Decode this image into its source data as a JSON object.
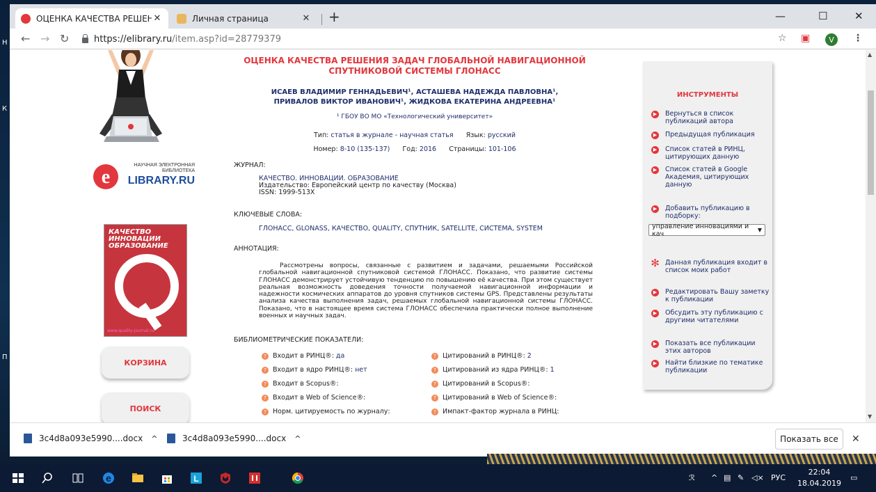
{
  "browser": {
    "tabs": [
      {
        "title": "ОЦЕНКА КАЧЕСТВА РЕШЕНИЯ З",
        "active": true
      },
      {
        "title": "Личная страница",
        "active": false
      }
    ],
    "url_host": "https://elibrary.ru",
    "url_path": "/item.asp?id=28779379",
    "avatar_letter": "V"
  },
  "site": {
    "logo_top": "НАУЧНАЯ ЭЛЕКТРОННАЯ",
    "logo_mid": "БИБЛИОТЕКА",
    "logo_main": "LIBRARY.RU",
    "cover_title": "КАЧЕСТВО ИННОВАЦИИ ОБРАЗОВАНИЕ",
    "cover_footer": "www.quality-journal.ru",
    "nav_cart": "КОРЗИНА",
    "nav_search": "ПОИСК"
  },
  "article": {
    "title_line1": "ОЦЕНКА КАЧЕСТВА РЕШЕНИЯ ЗАДАЧ ГЛОБАЛЬНОЙ НАВИГАЦИОННОЙ",
    "title_line2": "СПУТНИКОВОЙ СИСТЕМЫ ГЛОНАСС",
    "authors_line1": "ИСАЕВ ВЛАДИМИР ГЕННАДЬЕВИЧ¹, АСТАШЕВА НАДЕЖДА ПАВЛОВНА¹,",
    "authors_line2": "ПРИВАЛОВ ВИКТОР ИВАНОВИЧ¹, ЖИДКОВА ЕКАТЕРИНА АНДРЕЕВНА¹",
    "affiliation": "¹ ГБОУ ВО МО «Технологический университет»",
    "type_label": "Тип:",
    "type_value": "статья в журнале - научная статья",
    "lang_label": "Язык:",
    "lang_value": "русский",
    "number_label": "Номер:",
    "number_value": "8-10 (135-137)",
    "year_label": "Год:",
    "year_value": "2016",
    "pages_label": "Страницы:",
    "pages_value": "101-106",
    "journal_heading": "ЖУРНАЛ:",
    "journal_name": "КАЧЕСТВО. ИННОВАЦИИ. ОБРАЗОВАНИЕ",
    "publisher": "Издательство: Европейский центр по качеству (Москва)",
    "issn": "ISSN: 1999-513X",
    "keywords_heading": "КЛЮЧЕВЫЕ СЛОВА:",
    "keywords": "ГЛОНАСС, GLONASS, КАЧЕСТВО, QUALITY, СПУТНИК, SATELLITE, СИСТЕМА, SYSTEM",
    "abstract_heading": "АННОТАЦИЯ:",
    "abstract": "Рассмотрены вопросы, связанные с развитием и задачами, решаемыми Российской глобальной навигационной спутниковой системой ГЛОНАСС. Показано, что развитие системы ГЛОНАСС демонстрирует устойчивую тенденцию по повышению её качества. При этом существует реальная возможность доведения точности получаемой навигационной информации и надежности космических аппаратов до уровня спутников системы GPS. Представлены результаты анализа качества выполнения задач, решаемых глобальной навигационной системы ГЛОНАСС. Показано, что в настоящее время система ГЛОНАСС обеспечила практически полное выполнение военных и научных задач.",
    "biblio_heading": "БИБЛИОМЕТРИЧЕСКИЕ ПОКАЗАТЕЛИ:",
    "metrics_left": [
      {
        "label": "Входит в РИНЦ®:",
        "value": "да"
      },
      {
        "label": "Входит в ядро РИНЦ®:",
        "value": "нет"
      },
      {
        "label": "Входит в Scopus®:",
        "value": ""
      },
      {
        "label": "Входит в Web of Science®:",
        "value": ""
      },
      {
        "label": "Норм. цитируемость по журналу:",
        "value": ""
      }
    ],
    "metrics_right": [
      {
        "label": "Цитирований в РИНЦ®:",
        "value": "2"
      },
      {
        "label": "Цитирований из ядра РИНЦ®:",
        "value": "1"
      },
      {
        "label": "Цитирований в Scopus®:",
        "value": ""
      },
      {
        "label": "Цитирований в Web of Science®:",
        "value": ""
      },
      {
        "label": "Импакт-фактор журнала в РИНЦ:",
        "value": ""
      }
    ]
  },
  "tools": {
    "heading": "ИНСТРУМЕНТЫ",
    "items": [
      "Вернуться в список публикаций автора",
      "Предыдущая публикация",
      "Список статей в РИНЦ, цитирующих данную",
      "Список статей в Google Академия, цитирующих данную",
      "Добавить публикацию в подборку:"
    ],
    "select_value": "управление инновациями и кач",
    "in_my_list": "Данная публикация входит в список моих работ",
    "items2": [
      "Редактировать Вашу заметку к публикации",
      "Обсудить эту публикацию с другими читателями",
      "Показать все публикации этих авторов",
      "Найти близкие по тематике публикации"
    ]
  },
  "downloads": {
    "files": [
      "3c4d8a093e5990....docx",
      "3c4d8a093e5990....docx"
    ],
    "show_all": "Показать все"
  },
  "taskbar": {
    "lang": "РУС",
    "time": "22:04",
    "date": "18.04.2019"
  },
  "colors": {
    "accent_red": "#e2373d",
    "link_blue": "#1f2e6b",
    "panel_gray": "#f0f0f0"
  }
}
